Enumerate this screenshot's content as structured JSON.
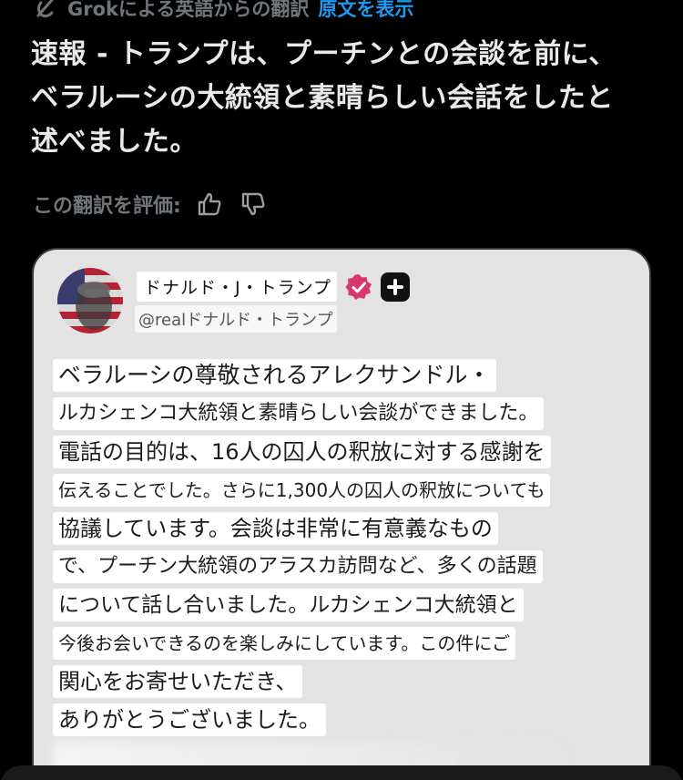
{
  "translation": {
    "credit": "Grokによる英語からの翻訳",
    "show_original": "原文を表示",
    "lines": [
      "速報 - トランプは、プーチンとの会談を前に、",
      "ベラルーシの大統領と素晴らしい会話をしたと",
      "述べました。"
    ]
  },
  "rating": {
    "label": "この翻訳を評価:",
    "thumbs_up_icon": "thumbs-up-icon",
    "thumbs_down_icon": "thumbs-down-icon"
  },
  "quoted_post": {
    "author_name": "ドナルド・J・トランプ",
    "handle": "@realドナルド・トランプ",
    "badges": [
      "verified-badge-icon",
      "plus-badge-icon"
    ],
    "lines": [
      "ベラルーシの尊敬されるアレクサンドル・",
      "ルカシェンコ大統領と素晴らしい会談ができました。",
      "電話の目的は、16人の囚人の釈放に対する感謝を",
      "伝えることでした。さらに1,300人の囚人の釈放についても",
      "協議しています。会談は非常に有意義なもの",
      "で、プーチン大統領のアラスカ訪問など、多くの話題",
      "について話し合いました。ルカシェンコ大統領と",
      "今後お会いできるのを楽しみにしています。この件にご",
      "関心をお寄せいただき、",
      "ありがとうございました。"
    ]
  },
  "colors": {
    "background": "#000000",
    "text": "#e7e9ea",
    "muted": "#71767b",
    "link": "#1d9bf0",
    "card": "#e3e3e3",
    "verified": "#d9366f"
  }
}
